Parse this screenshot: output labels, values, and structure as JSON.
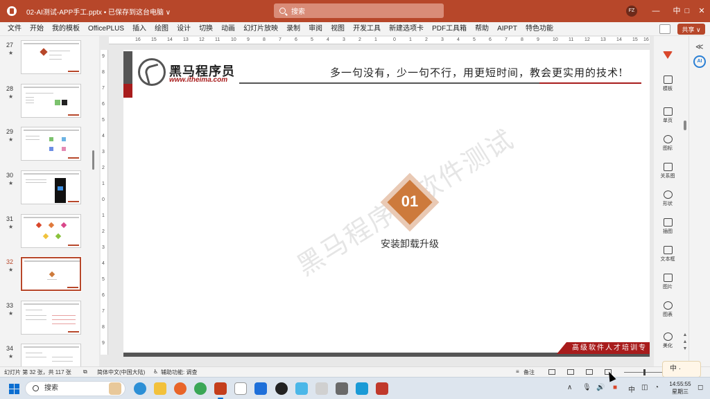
{
  "window": {
    "title": "02-AI测试-APP手工.pptx • 已保存到这台电脑 ∨",
    "search_placeholder": "搜索",
    "avatar_initials": "FZ",
    "minimize": "—",
    "restore": "中",
    "maximize": "□",
    "close": "✕"
  },
  "menu": [
    "文件",
    "开始",
    "我的模板",
    "OfficePLUS",
    "插入",
    "绘图",
    "设计",
    "切换",
    "动画",
    "幻灯片放映",
    "录制",
    "审阅",
    "视图",
    "开发工具",
    "新建选项卡",
    "PDF工具箱",
    "帮助",
    "AIPPT",
    "特色功能"
  ],
  "share_label": "共享 ∨",
  "thumbnails": [
    {
      "number": "27",
      "star": "★"
    },
    {
      "number": "28",
      "star": "★"
    },
    {
      "number": "29",
      "star": "★"
    },
    {
      "number": "30",
      "star": "★"
    },
    {
      "number": "31",
      "star": "★"
    },
    {
      "number": "32",
      "star": "★",
      "selected": true
    },
    {
      "number": "33",
      "star": "★"
    },
    {
      "number": "34",
      "star": "★"
    }
  ],
  "ruler_h": [
    "16",
    "15",
    "14",
    "13",
    "12",
    "11",
    "10",
    "9",
    "8",
    "7",
    "6",
    "5",
    "4",
    "3",
    "2",
    "1",
    "0",
    "1",
    "2",
    "3",
    "4",
    "5",
    "6",
    "7",
    "8",
    "9",
    "10",
    "11",
    "12",
    "13",
    "14",
    "15",
    "16"
  ],
  "ruler_v": [
    "9",
    "8",
    "7",
    "6",
    "5",
    "4",
    "3",
    "2",
    "1",
    "0",
    "1",
    "2",
    "3",
    "4",
    "5",
    "6",
    "7",
    "8",
    "9"
  ],
  "slide": {
    "brand_cn": "黑马程序员",
    "brand_url": "www.itheima.com",
    "slogan": "多一句没有，少一句不行，用更短时间，教会更实用的技术!",
    "section_number": "01",
    "section_title": "安装卸载升级",
    "watermark": "黑马程序员软件测试",
    "footer_tag": "高级软件人才培训专"
  },
  "right_pane": [
    {
      "label": "模板",
      "icon": "template-icon"
    },
    {
      "label": "单页",
      "icon": "single-page-icon"
    },
    {
      "label": "图标",
      "icon": "icons-icon"
    },
    {
      "label": "关系图",
      "icon": "relationship-icon"
    },
    {
      "label": "形状",
      "icon": "shapes-icon"
    },
    {
      "label": "插图",
      "icon": "illustration-icon"
    },
    {
      "label": "文本框",
      "icon": "textbox-icon"
    },
    {
      "label": "图片",
      "icon": "picture-icon"
    },
    {
      "label": "图表",
      "icon": "chart-icon"
    },
    {
      "label": "美化",
      "icon": "beautify-icon"
    }
  ],
  "ai_label": "AI",
  "status": {
    "slide_info": "幻灯片 第 32 张，共 117 张",
    "language": "简体中文(中国大陆)",
    "accessibility": "辅助功能: 调查",
    "notes": "备注"
  },
  "ime": "中 ·",
  "taskbar": {
    "search_label": "搜索",
    "time": "14:55:55",
    "date": "星期三"
  },
  "colors": {
    "accent": "#b7472a",
    "brand_red": "#a81c1c",
    "section_orange": "#cd7a3c"
  }
}
